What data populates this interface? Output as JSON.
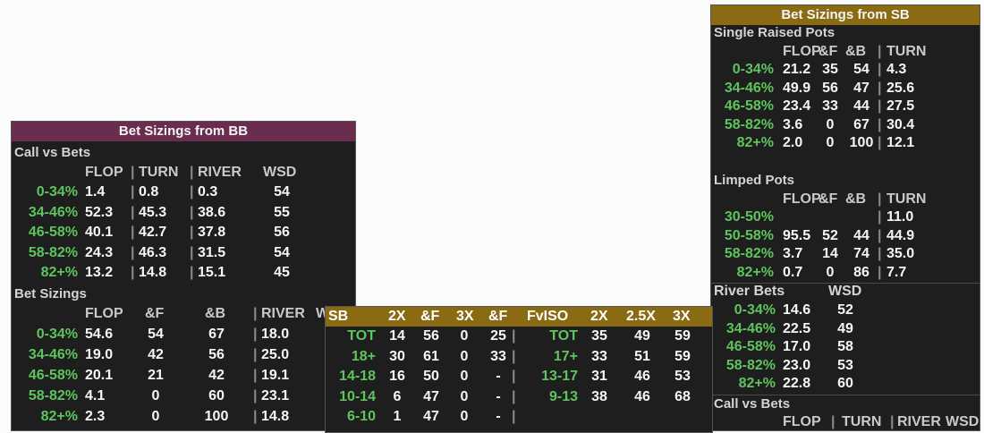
{
  "bb_panel": {
    "title": "Bet Sizings from BB",
    "title_color": "#6b2d4f",
    "call_vs_bets": {
      "heading": "Call vs Bets",
      "columns": [
        "FLOP",
        "TURN",
        "RIVER",
        "WSD"
      ],
      "rows": [
        {
          "label": "0-34%",
          "flop": "1.4",
          "turn": "0.8",
          "river": "0.3",
          "wsd": "54"
        },
        {
          "label": "34-46%",
          "flop": "52.3",
          "turn": "45.3",
          "river": "38.6",
          "wsd": "55"
        },
        {
          "label": "46-58%",
          "flop": "40.1",
          "turn": "42.7",
          "river": "37.8",
          "wsd": "56"
        },
        {
          "label": "58-82%",
          "flop": "24.3",
          "turn": "46.3",
          "river": "31.5",
          "wsd": "54"
        },
        {
          "label": "82+%",
          "flop": "13.2",
          "turn": "14.8",
          "river": "15.1",
          "wsd": "45"
        }
      ]
    },
    "bet_sizings": {
      "heading": "Bet Sizings",
      "columns": [
        "FLOP",
        "&F",
        "&B",
        "RIVER",
        "WSD"
      ],
      "rows": [
        {
          "label": "0-34%",
          "flop": "54.6",
          "f": "54",
          "b": "67",
          "river": "18.0"
        },
        {
          "label": "34-46%",
          "flop": "19.0",
          "f": "42",
          "b": "56",
          "river": "25.0"
        },
        {
          "label": "46-58%",
          "flop": "20.1",
          "f": "21",
          "b": "42",
          "river": "19.1"
        },
        {
          "label": "58-82%",
          "flop": "4.1",
          "f": "0",
          "b": "60",
          "river": "23.1"
        },
        {
          "label": "82+%",
          "flop": "2.3",
          "f": "0",
          "b": "100",
          "river": "14.8"
        }
      ]
    }
  },
  "mid_panel": {
    "header_color": "#8a6a12",
    "headers": [
      "SB",
      "2X",
      "&F",
      "3X",
      "&F",
      "FvISO",
      "2X",
      "2.5X",
      "3X"
    ],
    "rows": [
      {
        "l1": "TOT",
        "a": "14",
        "b": "56",
        "c": "0",
        "d": "25",
        "l2": "TOT",
        "e": "35",
        "f": "49",
        "g": "59"
      },
      {
        "l1": "18+",
        "a": "30",
        "b": "61",
        "c": "0",
        "d": "33",
        "l2": "17+",
        "e": "33",
        "f": "51",
        "g": "59"
      },
      {
        "l1": "14-18",
        "a": "16",
        "b": "50",
        "c": "0",
        "d": "-",
        "l2": "13-17",
        "e": "31",
        "f": "46",
        "g": "53"
      },
      {
        "l1": "10-14",
        "a": "6",
        "b": "47",
        "c": "0",
        "d": "-",
        "l2": "9-13",
        "e": "38",
        "f": "46",
        "g": "68"
      },
      {
        "l1": "6-10",
        "a": "1",
        "b": "47",
        "c": "0",
        "d": "-",
        "l2": "",
        "e": "",
        "f": "",
        "g": ""
      }
    ]
  },
  "sb_panel": {
    "title": "Bet Sizings from SB",
    "title_color": "#8a6a12",
    "single_raised": {
      "heading": "Single Raised Pots",
      "columns": [
        "FLOP",
        "&F",
        "&B",
        "TURN"
      ],
      "rows": [
        {
          "label": "0-34%",
          "flop": "21.2",
          "f": "35",
          "b": "54",
          "turn": "4.3"
        },
        {
          "label": "34-46%",
          "flop": "49.9",
          "f": "56",
          "b": "47",
          "turn": "25.6"
        },
        {
          "label": "46-58%",
          "flop": "23.4",
          "f": "33",
          "b": "44",
          "turn": "27.5"
        },
        {
          "label": "58-82%",
          "flop": "3.6",
          "f": "0",
          "b": "67",
          "turn": "30.4"
        },
        {
          "label": "82+%",
          "flop": "2.0",
          "f": "0",
          "b": "100",
          "turn": "12.1"
        }
      ]
    },
    "limped": {
      "heading": "Limped Pots",
      "columns": [
        "FLOP",
        "&F",
        "&B",
        "TURN"
      ],
      "rows": [
        {
          "label": "30-50%",
          "flop": "",
          "f": "",
          "b": "",
          "turn": "11.0"
        },
        {
          "label": "50-58%",
          "flop": "95.5",
          "f": "52",
          "b": "44",
          "turn": "44.9"
        },
        {
          "label": "58-82%",
          "flop": "3.7",
          "f": "14",
          "b": "74",
          "turn": "35.0"
        },
        {
          "label": "82+%",
          "flop": "0.7",
          "f": "0",
          "b": "86",
          "turn": "7.7"
        }
      ]
    },
    "river_bets": {
      "heading": "River Bets",
      "wsd_label": "WSD",
      "rows": [
        {
          "label": "0-34%",
          "val": "14.6",
          "wsd": "52"
        },
        {
          "label": "34-46%",
          "val": "22.5",
          "wsd": "49"
        },
        {
          "label": "46-58%",
          "val": "17.0",
          "wsd": "58"
        },
        {
          "label": "58-82%",
          "val": "23.0",
          "wsd": "53"
        },
        {
          "label": "82+%",
          "val": "22.8",
          "wsd": "60"
        }
      ]
    },
    "call_vs_bets": {
      "heading": "Call vs Bets",
      "columns": [
        "FLOP",
        "TURN",
        "RIVER",
        "WSD"
      ]
    }
  }
}
